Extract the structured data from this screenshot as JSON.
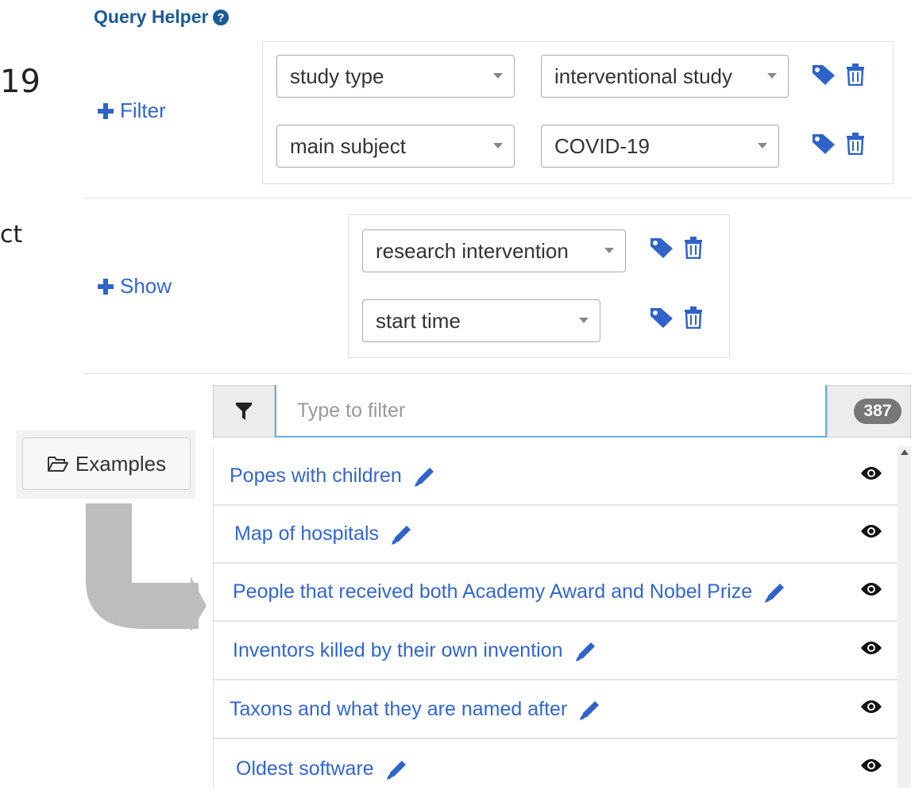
{
  "query_helper": {
    "title": "Query Helper",
    "side_text_top": "19",
    "side_text_mid": "ct",
    "filter_link": "Filter",
    "filters": [
      {
        "property": "study type",
        "value": "interventional study"
      },
      {
        "property": "main subject",
        "value": "COVID-19"
      }
    ],
    "show_link": "Show",
    "shows": [
      {
        "property": "research intervention"
      },
      {
        "property": "start time"
      }
    ]
  },
  "examples_button": "Examples",
  "filter_bar": {
    "placeholder": "Type to filter",
    "count": "387"
  },
  "examples": [
    {
      "title": "Popes with children"
    },
    {
      "title": "Map of hospitals"
    },
    {
      "title": "People that received both Academy Award and Nobel Prize"
    },
    {
      "title": "Inventors killed by their own invention"
    },
    {
      "title": "Taxons and what they are named after"
    },
    {
      "title": "Oldest software"
    }
  ],
  "colors": {
    "link": "#3366cc",
    "title": "#1a5b93",
    "icon_blue": "#2f63c9",
    "arrow_gray": "#bdbdbd"
  }
}
